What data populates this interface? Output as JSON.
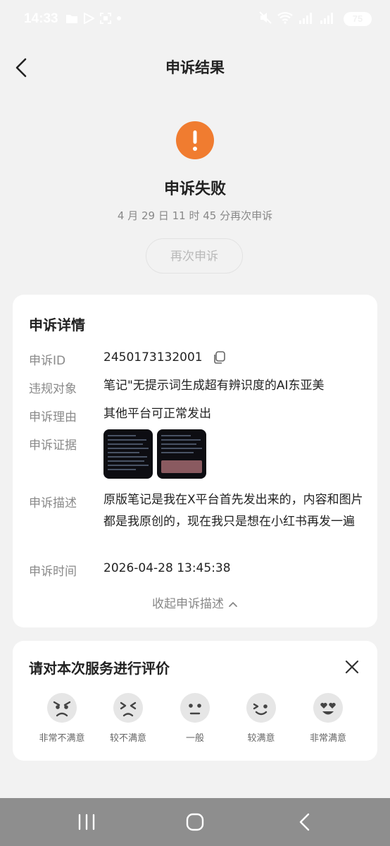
{
  "status_bar": {
    "time": "14:33",
    "battery": "75"
  },
  "header": {
    "title": "申诉结果"
  },
  "result": {
    "title": "申诉失败",
    "subtitle": "4 月 29 日 11 时 45 分再次申诉",
    "retry_label": "再次申诉",
    "icon_color": "#f07c30"
  },
  "details": {
    "title": "申诉详情",
    "rows": [
      {
        "label": "申诉ID",
        "value": "2450173132001"
      },
      {
        "label": "违规对象",
        "value": "笔记\"无提示词生成超有辨识度的AI东亚美"
      },
      {
        "label": "申诉理由",
        "value": "其他平台可正常发出"
      },
      {
        "label": "申诉证据",
        "value": ""
      },
      {
        "label": "申诉描述",
        "value": "原版笔记是我在X平台首先发出来的，内容和图片都是我原创的，现在我只是想在小红书再发一遍"
      },
      {
        "label": "申诉时间",
        "value": "2026-04-28 13:45:38"
      }
    ],
    "collapse_label": "收起申诉描述"
  },
  "rating": {
    "title": "请对本次服务进行评价",
    "options": [
      {
        "label": "非常不满意",
        "icon": "very-unsatisfied-face"
      },
      {
        "label": "较不满意",
        "icon": "unsatisfied-face"
      },
      {
        "label": "一般",
        "icon": "neutral-face"
      },
      {
        "label": "较满意",
        "icon": "satisfied-face"
      },
      {
        "label": "非常满意",
        "icon": "very-satisfied-face"
      }
    ]
  }
}
